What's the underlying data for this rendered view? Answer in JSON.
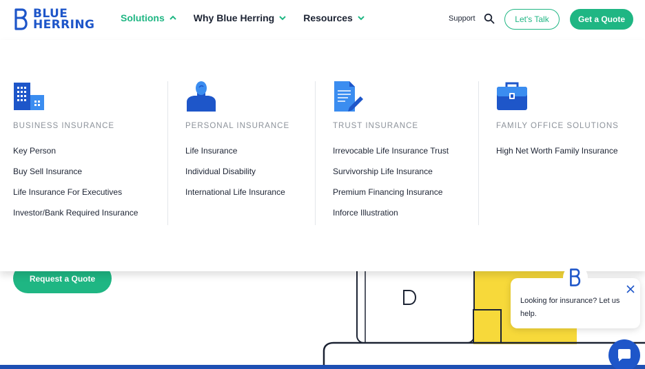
{
  "brand": {
    "name_line1": "BLUE",
    "name_line2": "HERRING",
    "color": "#1e56c9",
    "accent": "#1fb683"
  },
  "nav": {
    "items": [
      {
        "label": "Solutions",
        "state": "expanded"
      },
      {
        "label": "Why Blue Herring",
        "state": "collapsed"
      },
      {
        "label": "Resources",
        "state": "collapsed"
      }
    ],
    "support_label": "Support",
    "talk_label": "Let's Talk",
    "quote_label": "Get a Quote"
  },
  "dropdown": {
    "columns": [
      {
        "title": "BUSINESS INSURANCE",
        "icon": "building-icon",
        "links": [
          "Key Person",
          "Buy Sell Insurance",
          "Life Insurance For Executives",
          "Investor/Bank Required Insurance"
        ]
      },
      {
        "title": "PERSONAL INSURANCE",
        "icon": "person-icon",
        "links": [
          "Life Insurance",
          "Individual Disability",
          "International Life Insurance"
        ]
      },
      {
        "title": "TRUST INSURANCE",
        "icon": "document-pen-icon",
        "links": [
          "Irrevocable Life Insurance Trust",
          "Survivorship Life Insurance",
          "Premium Financing Insurance",
          "Inforce Illustration"
        ]
      },
      {
        "title": "FAMILY OFFICE SOLUTIONS",
        "icon": "briefcase-icon",
        "links": [
          "High Net Worth Family Insurance"
        ]
      }
    ]
  },
  "hero": {
    "request_label": "Request a Quote"
  },
  "chat": {
    "message": "Looking for insurance? Let us help."
  }
}
